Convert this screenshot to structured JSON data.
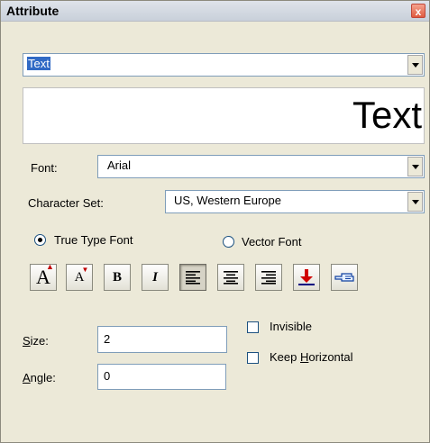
{
  "window": {
    "title": "Attribute",
    "close_glyph": "x"
  },
  "element_select": {
    "value": "Text"
  },
  "preview": {
    "text": "Text"
  },
  "font": {
    "label": "Font:",
    "value": "Arial"
  },
  "charset": {
    "label": "Character Set:",
    "value": "US, Western Europe"
  },
  "font_type": {
    "truetype_label": "True Type Font",
    "vector_label": "Vector Font",
    "selected": "truetype"
  },
  "toolbar": {
    "bigger": "A",
    "smaller": "A",
    "bold": "B",
    "italic": "I"
  },
  "size": {
    "label_pre": "",
    "label_u": "S",
    "label_post": "ize:",
    "value": "2"
  },
  "angle": {
    "label_u": "A",
    "label_post": "ngle:",
    "value": "0"
  },
  "invisible": {
    "label": "Invisible",
    "checked": false
  },
  "keep_horizontal": {
    "label_pre": "Keep ",
    "label_u": "H",
    "label_post": "orizontal",
    "checked": false
  }
}
